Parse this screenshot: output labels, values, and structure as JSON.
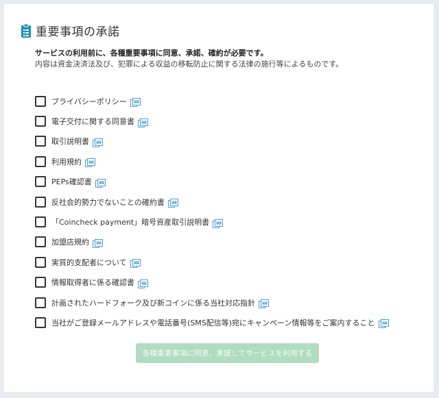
{
  "header": {
    "title": "重要事項の承諾",
    "icon": "clipboard-list-icon",
    "accent": "#1a93b8"
  },
  "intro": {
    "bold": "サービスの利用前に、各種重要事項に同意、承諾、確約が必要です。",
    "normal": "内容は資金決済法及び、犯罪による収益の移転防止に関する法律の施行等によるものです。"
  },
  "items": [
    {
      "label": "プライバシーポリシー",
      "checked": false,
      "icon": "pdf-icon"
    },
    {
      "label": "電子交付に関する同意書",
      "checked": false,
      "icon": "pdf-icon"
    },
    {
      "label": "取引説明書",
      "checked": false,
      "icon": "pdf-icon"
    },
    {
      "label": "利用規約",
      "checked": false,
      "icon": "pdf-icon"
    },
    {
      "label": "PEPs確認書",
      "checked": false,
      "icon": "pdf-icon"
    },
    {
      "label": "反社会的勢力でないことの確約書",
      "checked": false,
      "icon": "pdf-icon"
    },
    {
      "label": "「Coincheck payment」暗号資産取引説明書",
      "checked": false,
      "icon": "pdf-icon"
    },
    {
      "label": "加盟店規約",
      "checked": false,
      "icon": "pdf-icon"
    },
    {
      "label": "実質的支配者について",
      "checked": false,
      "icon": "pdf-icon"
    },
    {
      "label": "情報取得者に係る確認書",
      "checked": false,
      "icon": "pdf-icon"
    },
    {
      "label": "計画されたハードフォーク及び新コインに係る当社対応指針",
      "checked": false,
      "icon": "pdf-icon"
    },
    {
      "label": "当社がご登録メールアドレスや電話番号(SMS配信等)宛にキャンペーン情報等をご案内すること",
      "checked": false,
      "icon": "pdf-icon"
    }
  ],
  "submit": {
    "label": "各種重要事項に同意、承諾してサービスを利用する",
    "disabled": true,
    "color": "#b0dcc2"
  }
}
